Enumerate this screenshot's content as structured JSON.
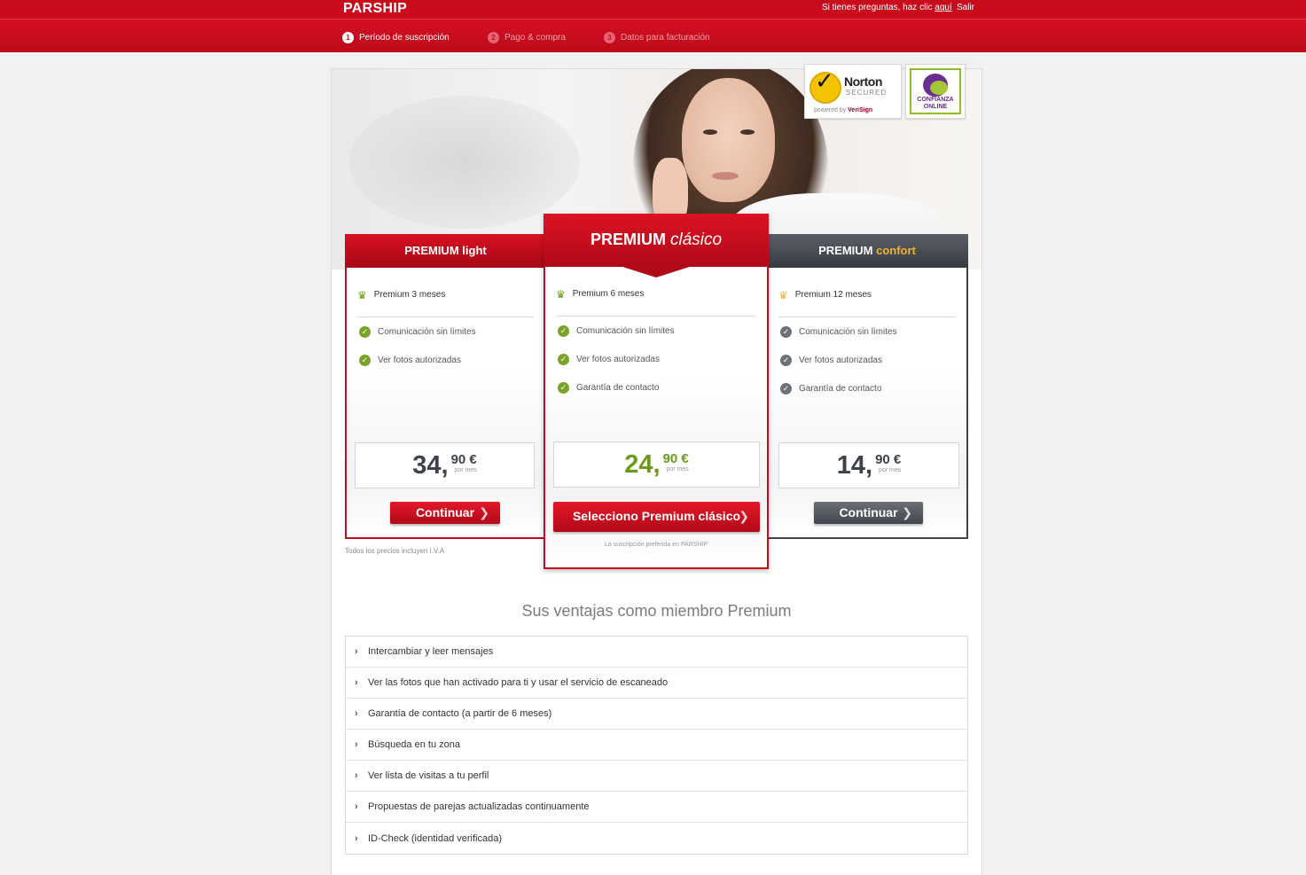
{
  "header": {
    "logo": "PARSHIP",
    "help_text": "Si tienes preguntas, haz clic ",
    "help_link": "aquí",
    "logout": "Salir"
  },
  "steps": [
    {
      "num": "1",
      "label": "Período de suscripción",
      "active": true
    },
    {
      "num": "2",
      "label": "Pago & compra",
      "active": false
    },
    {
      "num": "3",
      "label": "Datos para facturación",
      "active": false
    }
  ],
  "badges": {
    "norton_title": "Norton",
    "norton_sub": "SECURED",
    "norton_powered": "powered by ",
    "norton_brand": "VeriSign",
    "confianza": "CONFIANZA ONLINE"
  },
  "plans": {
    "light": {
      "title_a": "PREMIUM",
      "title_b": "light",
      "duration": "Premium 3 meses",
      "features": [
        "Comunicación sin límites",
        "Ver fotos autorizadas"
      ],
      "price_int": "34,",
      "price_dec": "90 €",
      "per": "por mes",
      "button": "Continuar"
    },
    "clasico": {
      "title_a": "PREMIUM",
      "title_b": "clásico",
      "duration": "Premium 6 meses",
      "features": [
        "Comunicación sin límites",
        "Ver fotos autorizadas",
        "Garantía de contacto"
      ],
      "price_int": "24,",
      "price_dec": "90 €",
      "per": "por mes",
      "button": "Selecciono Premium clásico",
      "note": "La suscripción preferida en PARSHIP"
    },
    "confort": {
      "title_a": "PREMIUM",
      "title_b": "confort",
      "duration": "Premium 12 meses",
      "features": [
        "Comunicación sin límites",
        "Ver fotos autorizadas",
        "Garantía de contacto"
      ],
      "price_int": "14,",
      "price_dec": "90 €",
      "per": "por mes",
      "button": "Continuar"
    }
  },
  "iva_note": "Todos los precios incluyen I.V.A",
  "benefits": {
    "title": "Sus ventajas como miembro Premium",
    "items": [
      "Intercambiar y leer mensajes",
      "Ver las fotos que han activado para ti y usar el servicio de escaneado",
      "Garantía de contacto (a partir de 6 meses)",
      "Búsqueda en tu zona",
      "Ver lista de visitas a tu perfil",
      "Propuestas de parejas actualizadas continuamente",
      "ID-Check (identidad verificada)"
    ]
  },
  "colors": {
    "brand_red": "#c80c1c",
    "confort_dark": "#3f444b",
    "check_green": "#7aa428",
    "gold": "#f2b22f"
  }
}
